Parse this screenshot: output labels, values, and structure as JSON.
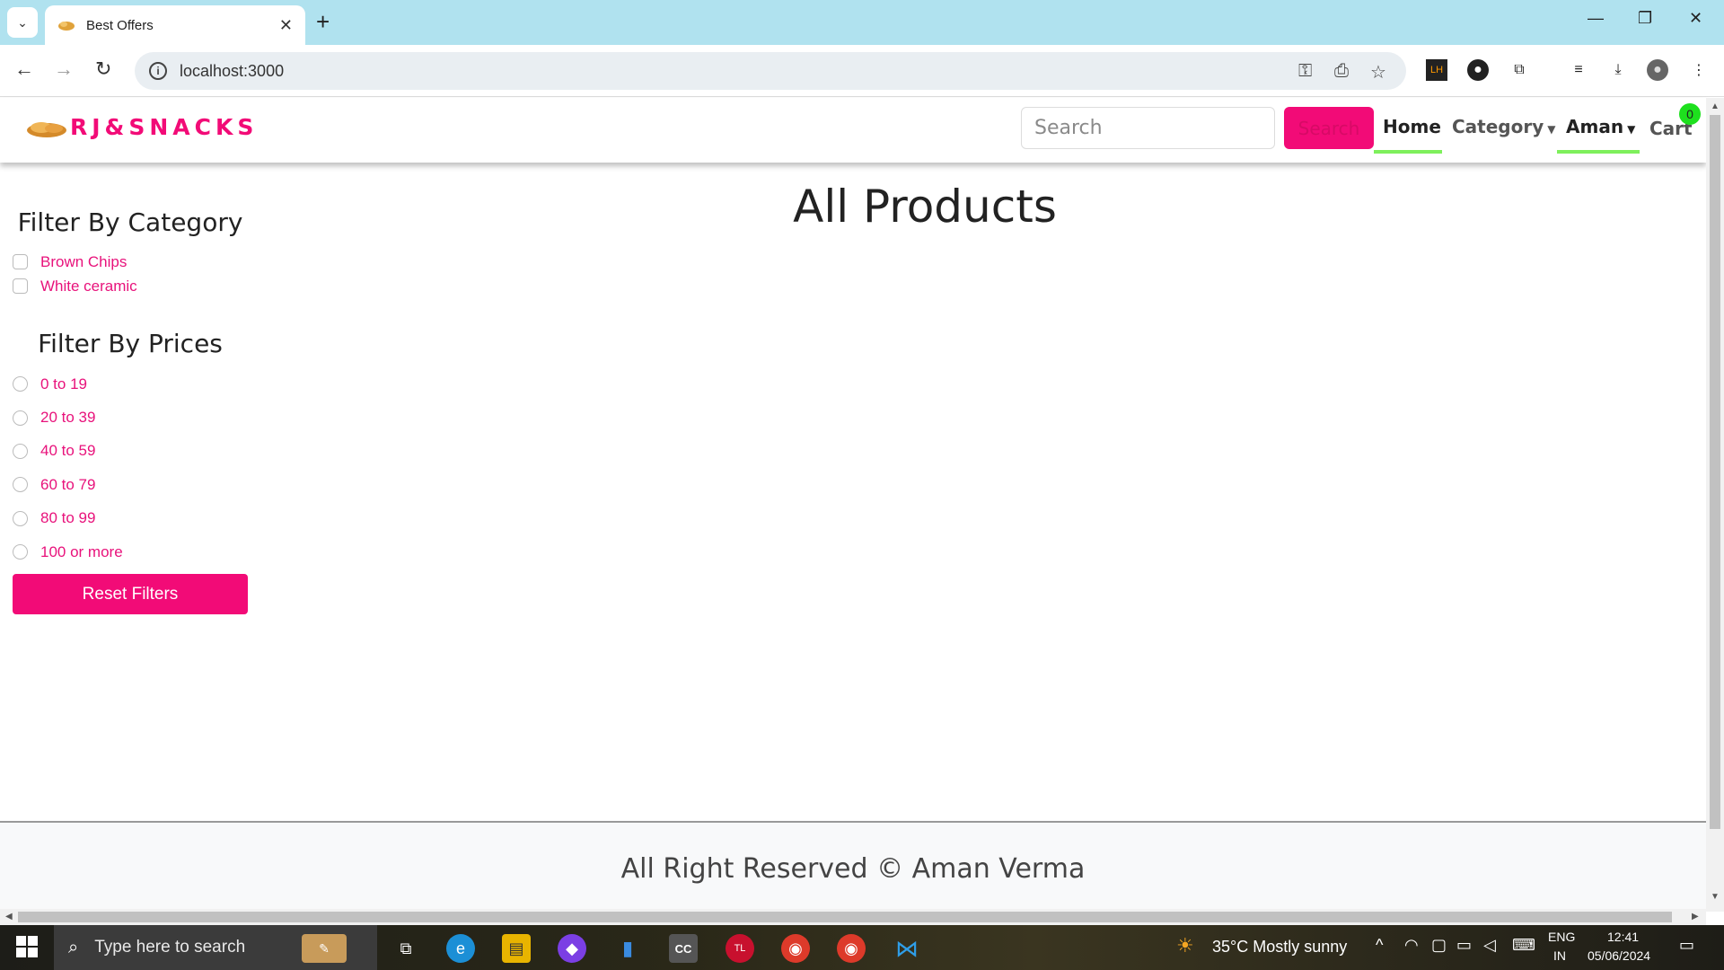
{
  "browser": {
    "tab_title": "Best Offers",
    "tab_close": "✕",
    "new_tab": "+",
    "url": "localhost:3000",
    "window_controls": {
      "minimize": "—",
      "restore": "❐",
      "close": "✕"
    }
  },
  "navbar": {
    "brand": "RJ&SNACKS",
    "search_placeholder": "Search",
    "search_button": "Search",
    "links": {
      "home": "Home",
      "category": "Category",
      "user": "Aman",
      "cart": "Cart"
    },
    "cart_count": "0",
    "colors": {
      "brand": "#f20b77",
      "active_underline": "#7ef05c",
      "badge": "#1ee01e"
    }
  },
  "sidebar": {
    "category_heading": "Filter By Category",
    "categories": [
      "Brown Chips",
      "White ceramic"
    ],
    "price_heading": "Filter By Prices",
    "prices": [
      "0 to 19",
      "20 to 39",
      "40 to 59",
      "60 to 79",
      "80 to 99",
      "100 or more"
    ],
    "reset_button": "Reset Filters"
  },
  "main": {
    "title": "All Products"
  },
  "footer": {
    "text": "All Right Reserved © Aman Verma"
  },
  "taskbar": {
    "search_text": "Type here to search",
    "weather": "35°C  Mostly sunny",
    "lang_top": "ENG",
    "lang_bottom": "IN",
    "time": "12:41",
    "date": "05/06/2024"
  }
}
